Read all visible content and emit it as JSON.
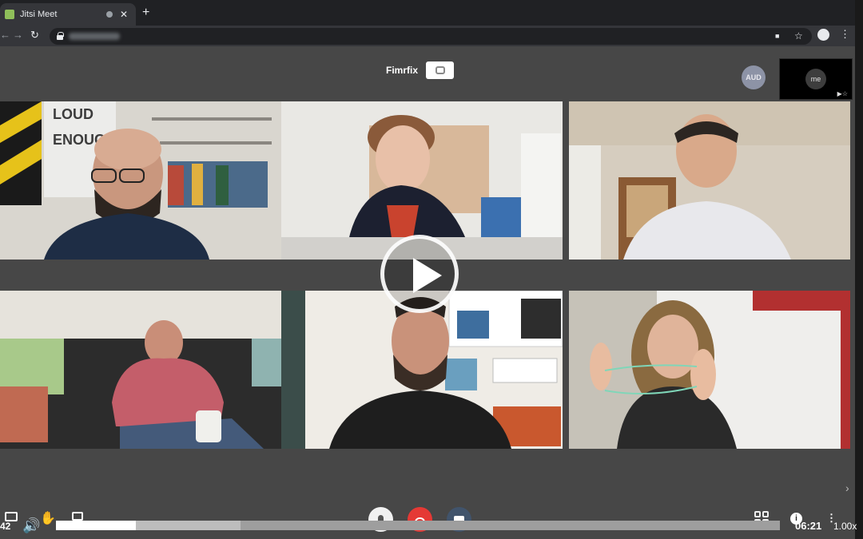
{
  "browser": {
    "tab_title": "Jitsi Meet",
    "tab_close": "✕",
    "new_tab": "+",
    "back": "←",
    "forward": "→",
    "reload": "↻",
    "camera_icon": "■",
    "bookmark_star": "☆",
    "menu": "⋮"
  },
  "meeting": {
    "conference_name": "Fimrfix",
    "participant_badge": "AUD",
    "self_view_label": "me",
    "self_view_icons": "▶☆",
    "next_page_arrow": "›"
  },
  "participants": [
    {
      "id": "wall-text-1",
      "text": "LOUD"
    },
    {
      "id": "wall-text-2",
      "text": "ENOUGH"
    }
  ],
  "player": {
    "elapsed": "42",
    "duration": "06:21",
    "speed": "1.00x",
    "played_fraction": 0.11,
    "buffered_fraction": 0.255,
    "volume_icon": "🔊",
    "hand_icon": "✋",
    "info_icon": "i",
    "more_icon": "⋮"
  },
  "colors": {
    "meeting_bg": "#474747",
    "hangup": "#e53935",
    "camera_button": "#41546c",
    "avatar": "#8d93a6"
  }
}
